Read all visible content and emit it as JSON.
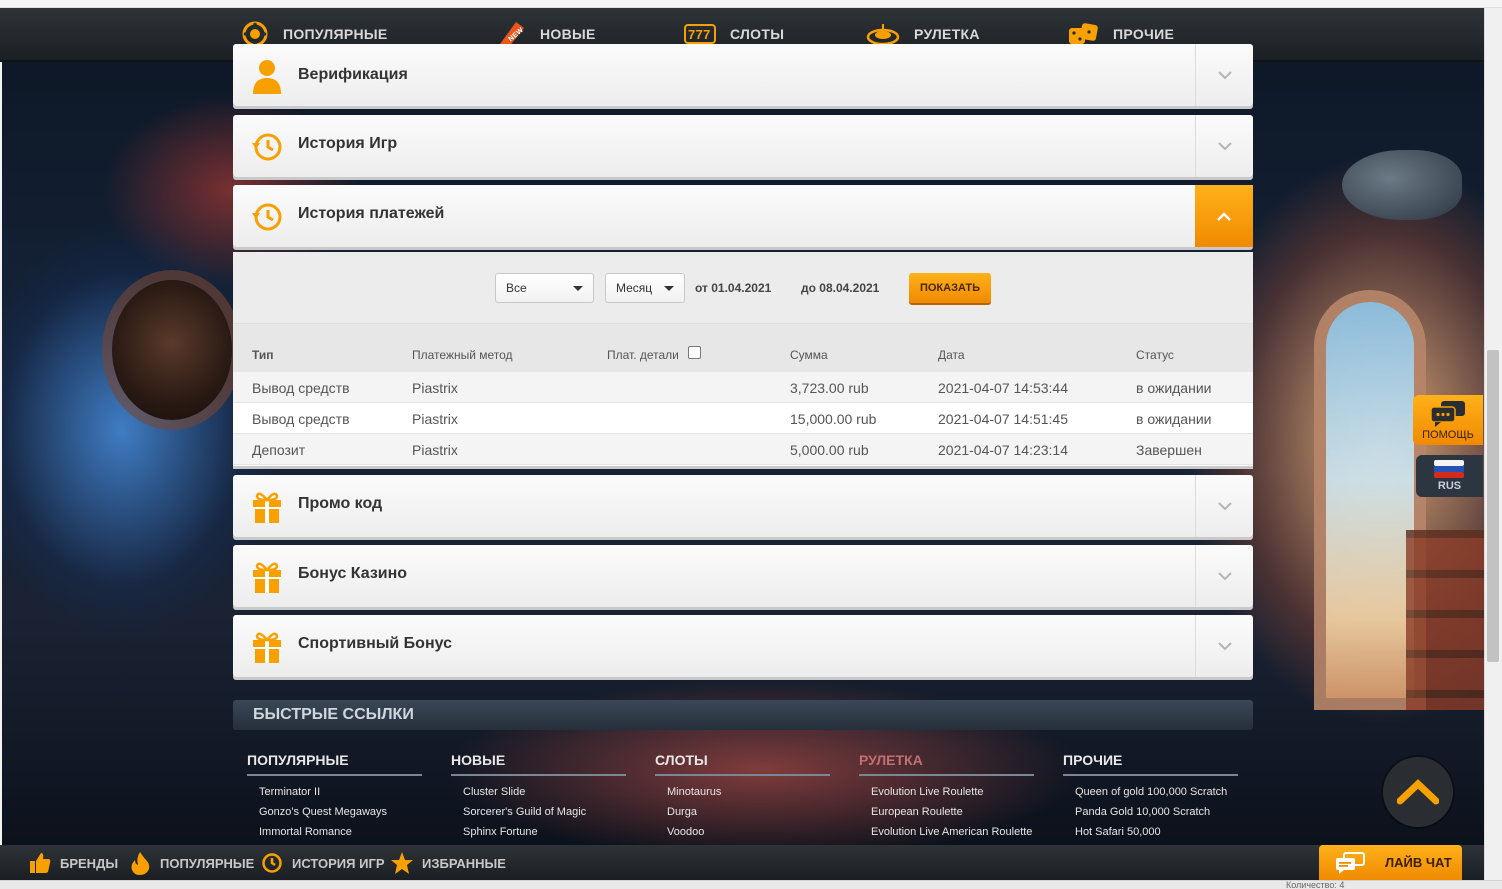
{
  "topnav": {
    "items": [
      {
        "label": "ПОПУЛЯРНЫЕ",
        "icon": "chip-icon"
      },
      {
        "label": "НОВЫЕ",
        "icon": "new-badge-icon",
        "badge": "NEW"
      },
      {
        "label": "СЛОТЫ",
        "icon": "slots-777-icon"
      },
      {
        "label": "РУЛЕТКА",
        "icon": "roulette-icon"
      },
      {
        "label": "ПРОЧИЕ",
        "icon": "dice-icon"
      }
    ]
  },
  "accordion": {
    "verification": {
      "title": "Верификация",
      "icon": "user-icon"
    },
    "game_history": {
      "title": "История Игр",
      "icon": "history-icon"
    },
    "payment_history": {
      "title": "История платежей",
      "icon": "history-icon",
      "open": true
    },
    "promo": {
      "title": "Промо код",
      "icon": "gift-icon"
    },
    "casino_bonus": {
      "title": "Бонус Казино",
      "icon": "gift-icon"
    },
    "sport_bonus": {
      "title": "Спортивный Бонус",
      "icon": "gift-icon"
    }
  },
  "payments": {
    "filter": {
      "type_value": "Все",
      "period_value": "Месяц",
      "from_label": "от 01.04.2021",
      "to_label": "до 08.04.2021",
      "show_button": "ПОКАЗАТЬ"
    },
    "columns": {
      "type": "Тип",
      "method": "Платежный метод",
      "details": "Плат. детали",
      "amount": "Сумма",
      "date": "Дата",
      "status": "Статус"
    },
    "rows": [
      {
        "type": "Вывод средств",
        "method": "Piastrix",
        "amount": "3,723.00 rub",
        "date": "2021-04-07 14:53:44",
        "status": "в ожидании"
      },
      {
        "type": "Вывод средств",
        "method": "Piastrix",
        "amount": "15,000.00 rub",
        "date": "2021-04-07 14:51:45",
        "status": "в ожидании"
      },
      {
        "type": "Депозит",
        "method": "Piastrix",
        "amount": "5,000.00 rub",
        "date": "2021-04-07 14:23:14",
        "status": "Завершен"
      }
    ]
  },
  "quick_links": {
    "title": "БЫСТРЫЕ ССЫЛКИ",
    "columns": [
      {
        "head": "ПОПУЛЯРНЫЕ",
        "links": [
          "Terminator II",
          "Gonzo's Quest Megaways",
          "Immortal Romance"
        ]
      },
      {
        "head": "НОВЫЕ",
        "links": [
          "Cluster Slide",
          "Sorcerer's Guild of Magic",
          "Sphinx Fortune"
        ]
      },
      {
        "head": "СЛОТЫ",
        "links": [
          "Minotaurus",
          "Durga",
          "Voodoo"
        ]
      },
      {
        "head": "РУЛЕТКА",
        "links": [
          "Evolution Live Roulette",
          "European Roulette",
          "Evolution Live American Roulette"
        ]
      },
      {
        "head": "ПРОЧИЕ",
        "links": [
          "Queen of gold 100,000 Scratch",
          "Panda Gold 10,000 Scratch",
          "Hot Safari 50,000"
        ]
      }
    ]
  },
  "side": {
    "help_label": "ПОМОЩЬ",
    "lang_label": "RUS"
  },
  "bottombar": {
    "items": [
      {
        "label": "БРЕНДЫ",
        "icon": "thumbs-up-icon"
      },
      {
        "label": "ПОПУЛЯРНЫЕ",
        "icon": "fire-icon"
      },
      {
        "label": "ИСТОРИЯ ИГР",
        "icon": "history-icon"
      },
      {
        "label": "ИЗБРАННЫЕ",
        "icon": "star-icon"
      }
    ],
    "live_chat": "ЛАЙВ ЧАТ"
  },
  "status": {
    "text": "Количество: 4"
  },
  "colors": {
    "accent": "#f7a000",
    "nav_bg": "#22272b"
  }
}
